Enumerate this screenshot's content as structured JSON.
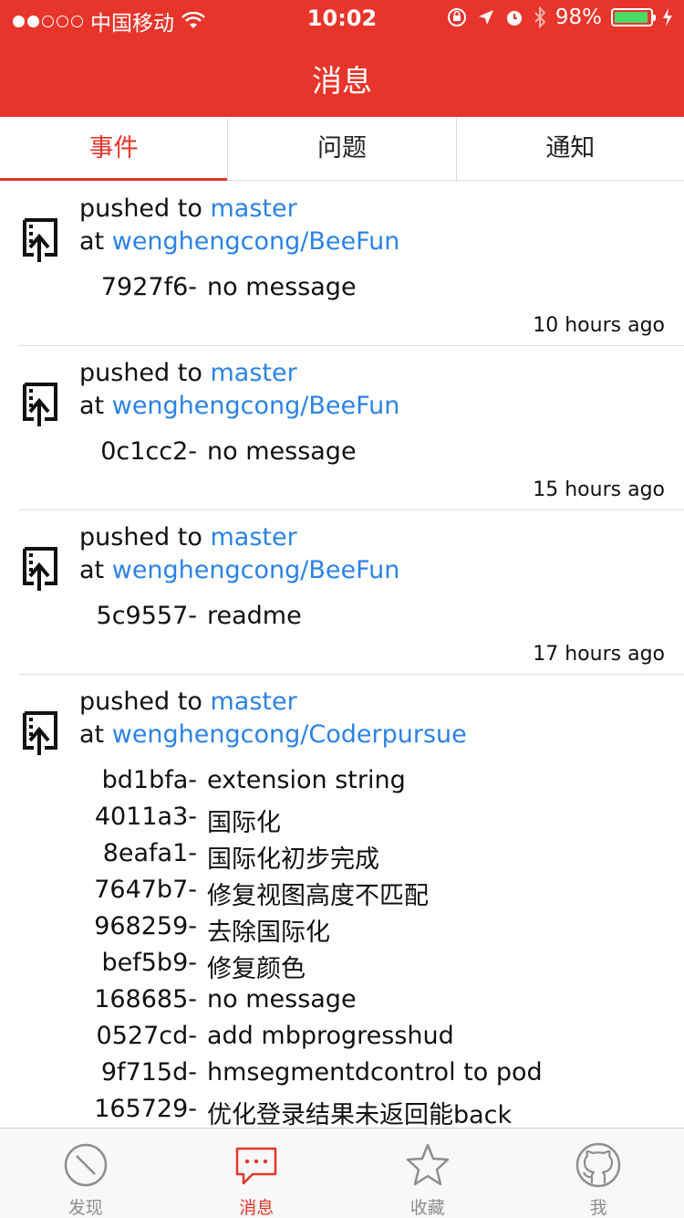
{
  "status_bar": {
    "carrier": "中国移动",
    "time": "10:02",
    "battery": "98%",
    "signal_bars_filled": 2,
    "signal_bars_total": 5,
    "battery_level": 0.98
  },
  "nav": {
    "title": "消息"
  },
  "segments": [
    {
      "label": "事件",
      "active": true
    },
    {
      "label": "问题",
      "active": false
    },
    {
      "label": "通知",
      "active": false
    }
  ],
  "feed": [
    {
      "action": "pushed to",
      "branch": "master",
      "at": "at",
      "repo": "wenghengcong/BeeFun",
      "commits": [
        {
          "sha": "7927f6-",
          "message": "no message"
        }
      ],
      "time": "10 hours ago"
    },
    {
      "action": "pushed to",
      "branch": "master",
      "at": "at",
      "repo": "wenghengcong/BeeFun",
      "commits": [
        {
          "sha": "0c1cc2-",
          "message": "no message"
        }
      ],
      "time": "15 hours ago"
    },
    {
      "action": "pushed to",
      "branch": "master",
      "at": "at",
      "repo": "wenghengcong/BeeFun",
      "commits": [
        {
          "sha": "5c9557-",
          "message": "readme"
        }
      ],
      "time": "17 hours ago"
    },
    {
      "action": "pushed to",
      "branch": "master",
      "at": "at",
      "repo": "wenghengcong/Coderpursue",
      "commits": [
        {
          "sha": "bd1bfa-",
          "message": "extension string"
        },
        {
          "sha": "4011a3-",
          "message": "国际化"
        },
        {
          "sha": "8eafa1-",
          "message": "国际化初步完成"
        },
        {
          "sha": "7647b7-",
          "message": "修复视图高度不匹配"
        },
        {
          "sha": "968259-",
          "message": "去除国际化"
        },
        {
          "sha": "bef5b9-",
          "message": "修复颜色"
        },
        {
          "sha": "168685-",
          "message": "no message"
        },
        {
          "sha": "0527cd-",
          "message": "add mbprogresshud"
        },
        {
          "sha": "9f715d-",
          "message": "hmsegmentdcontrol to pod"
        },
        {
          "sha": "165729-",
          "message": "优化登录结果未返回能back"
        }
      ],
      "time": ""
    }
  ],
  "tabbar": [
    {
      "label": "发现",
      "icon": "compass-icon",
      "active": false
    },
    {
      "label": "消息",
      "icon": "message-icon",
      "active": true
    },
    {
      "label": "收藏",
      "icon": "star-icon",
      "active": false
    },
    {
      "label": "我",
      "icon": "github-icon",
      "active": false
    }
  ],
  "colors": {
    "accent": "#e8352b",
    "link": "#2b83e6",
    "battery_fill": "#4cd964"
  }
}
